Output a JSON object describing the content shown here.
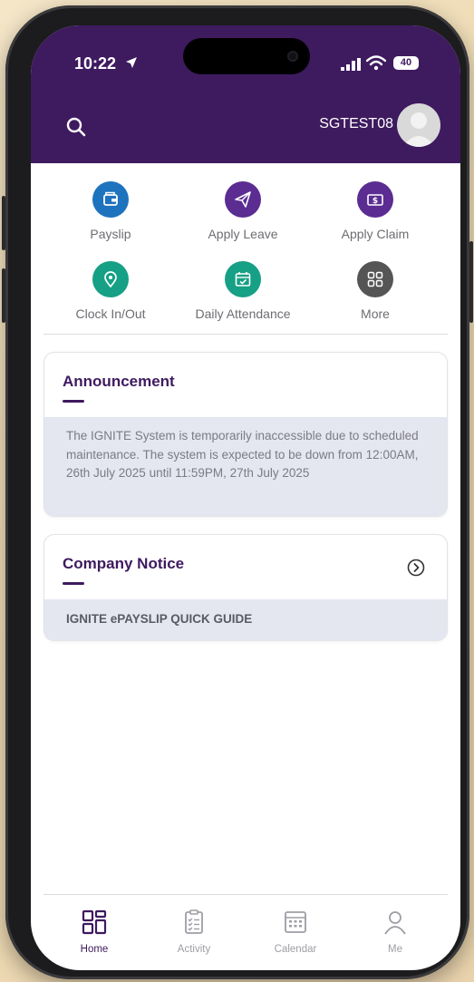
{
  "status_bar": {
    "time": "10:22",
    "battery": "40"
  },
  "header": {
    "username": "SGTEST08"
  },
  "quick_actions": [
    {
      "label": "Payslip",
      "icon": "wallet-icon",
      "color": "#1e73be"
    },
    {
      "label": "Apply Leave",
      "icon": "paper-plane-icon",
      "color": "#5b2c91"
    },
    {
      "label": "Apply Claim",
      "icon": "money-icon",
      "color": "#5b2c91"
    },
    {
      "label": "Clock In/Out",
      "icon": "location-pin-icon",
      "color": "#16a085"
    },
    {
      "label": "Daily Attendance",
      "icon": "calendar-check-icon",
      "color": "#16a085"
    },
    {
      "label": "More",
      "icon": "grid-icon",
      "color": "#555555"
    }
  ],
  "announcement": {
    "title": "Announcement",
    "text": "The IGNITE System is temporarily inaccessible due to scheduled maintenance. The system is expected to be down from 12:00AM, 26th July 2025 until 11:59PM, 27th July 2025"
  },
  "company_notice": {
    "title": "Company Notice",
    "items": [
      "IGNITE ePAYSLIP QUICK GUIDE"
    ]
  },
  "tabs": [
    {
      "label": "Home",
      "icon": "home-grid-icon",
      "active": true
    },
    {
      "label": "Activity",
      "icon": "clipboard-icon",
      "active": false
    },
    {
      "label": "Calendar",
      "icon": "calendar-icon",
      "active": false
    },
    {
      "label": "Me",
      "icon": "person-icon",
      "active": false
    }
  ],
  "colors": {
    "brand": "#3e1a5f",
    "card_body": "#e4e6f0"
  }
}
